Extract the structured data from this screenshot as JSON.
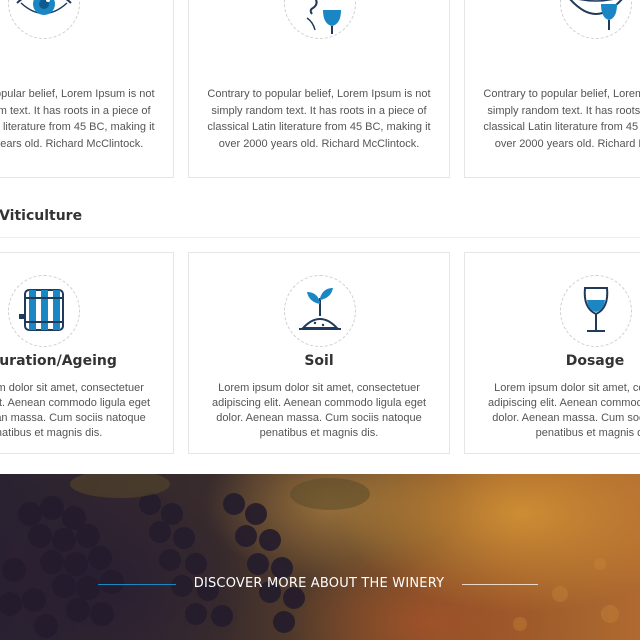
{
  "colors": {
    "accent": "#1b86c4",
    "icon_stroke": "#1f3a5a",
    "card_border": "#e6e6e6"
  },
  "top_cards": [
    {
      "icon": "eye-icon",
      "text": "Contrary to popular belief, Lorem Ipsum is not simply random text. It has roots in a piece of classical Latin literature from 45 BC, making it over 2000 years old. Richard McClintock."
    },
    {
      "icon": "nose-icon",
      "text": "Contrary to popular belief, Lorem Ipsum is not simply random text. It has roots in a piece of classical  Latin literature from 45 BC, making it over 2000 years old. Richard McClintock."
    },
    {
      "icon": "lips-icon",
      "text": "Contrary to popular belief, Lorem Ipsum is not simply random text. It has roots in a piece of classical  Latin literature from 45 BC, making it over 2000 years old. Richard McClintock."
    }
  ],
  "section": {
    "heading": "& Viticulture"
  },
  "bottom_cards": [
    {
      "icon": "barrel-icon",
      "title": "Maturation/Ageing",
      "text": "Lorem ipsum dolor sit amet, consectetuer adipiscing elit. Aenean commodo ligula eget dolor. Aenean massa. Cum sociis natoque penatibus et magnis dis."
    },
    {
      "icon": "sprout-icon",
      "title": "Soil",
      "text": "Lorem ipsum dolor sit amet, consectetuer adipiscing elit. Aenean commodo ligula eget dolor. Aenean massa. Cum sociis natoque penatibus et magnis dis."
    },
    {
      "icon": "wine-glass-icon",
      "title": "Dosage",
      "text": "Lorem ipsum dolor sit amet, consectetuer adipiscing elit. Aenean commodo ligula eget dolor. Aenean massa. Cum sociis natoque penatibus et magnis dis."
    }
  ],
  "banner": {
    "cta_label": "DISCOVER MORE ABOUT THE WINERY"
  }
}
